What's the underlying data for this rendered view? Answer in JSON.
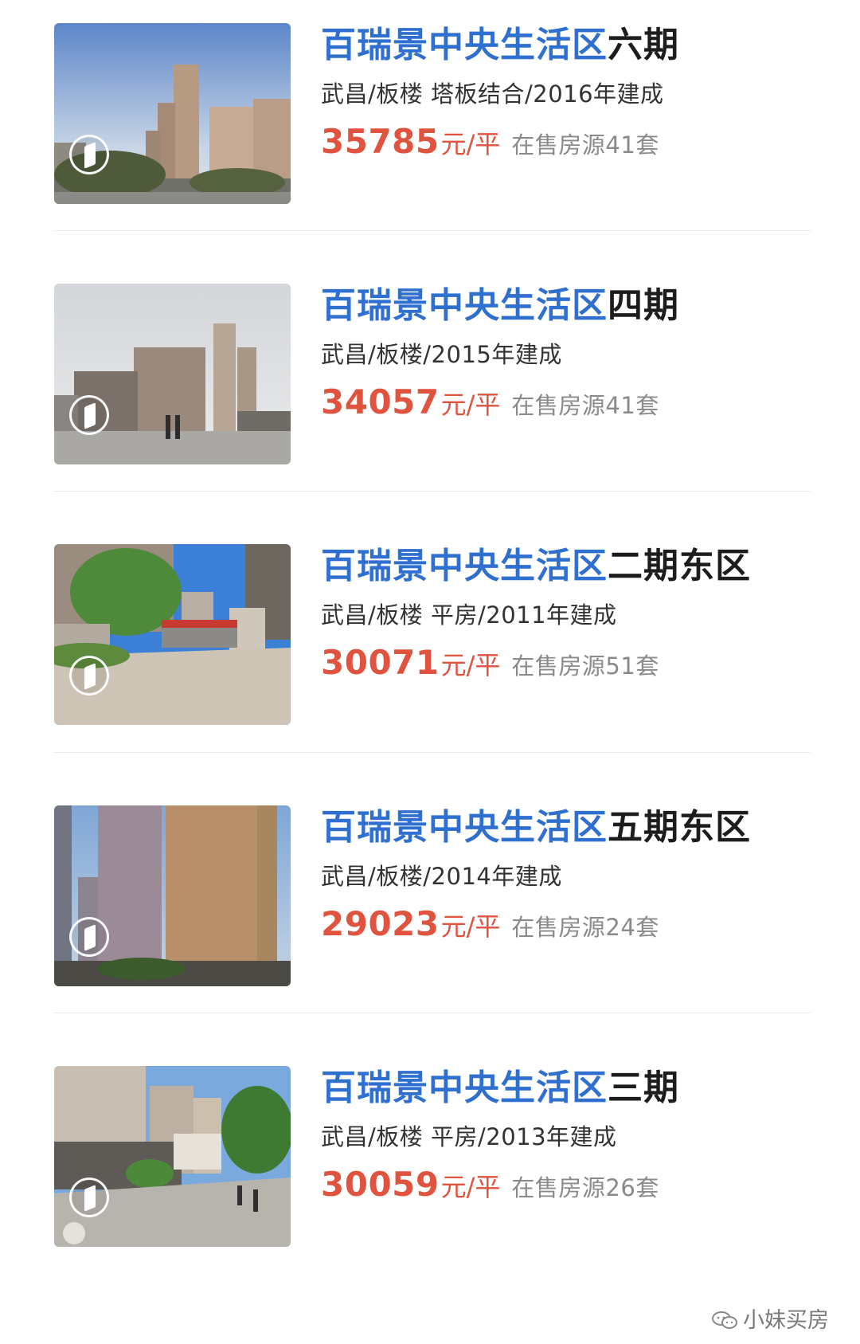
{
  "listings": [
    {
      "title_highlight": "百瑞景中央生活区",
      "title_rest": "六期",
      "meta": "武昌/板楼 塔板结合/2016年建成",
      "price": "35785",
      "unit": "元/平",
      "stock": "在售房源41套",
      "thumbnail": "tower-sky-photo",
      "vr_icon": "vr-panorama-icon"
    },
    {
      "title_highlight": "百瑞景中央生活区",
      "title_rest": "四期",
      "meta": "武昌/板楼/2015年建成",
      "price": "34057",
      "unit": "元/平",
      "stock": "在售房源41套",
      "thumbnail": "street-towers-photo",
      "vr_icon": "vr-panorama-icon"
    },
    {
      "title_highlight": "百瑞景中央生活区",
      "title_rest": "二期东区",
      "meta": "武昌/板楼 平房/2011年建成",
      "price": "30071",
      "unit": "元/平",
      "stock": "在售房源51套",
      "thumbnail": "gate-entrance-photo",
      "vr_icon": "vr-panorama-icon"
    },
    {
      "title_highlight": "百瑞景中央生活区",
      "title_rest": "五期东区",
      "meta": "武昌/板楼/2014年建成",
      "price": "29023",
      "unit": "元/平",
      "stock": "在售房源24套",
      "thumbnail": "highrise-photo",
      "vr_icon": "vr-panorama-icon"
    },
    {
      "title_highlight": "百瑞景中央生活区",
      "title_rest": "三期",
      "meta": "武昌/板楼 平房/2013年建成",
      "price": "30059",
      "unit": "元/平",
      "stock": "在售房源26套",
      "thumbnail": "plaza-street-photo",
      "vr_icon": "vr-panorama-icon"
    }
  ],
  "watermark": {
    "text": "小妹买房",
    "icon": "wechat-icon"
  },
  "colors": {
    "title_highlight": "#2f6fd0",
    "price": "#e0533e",
    "stock": "#8a8a8a"
  }
}
